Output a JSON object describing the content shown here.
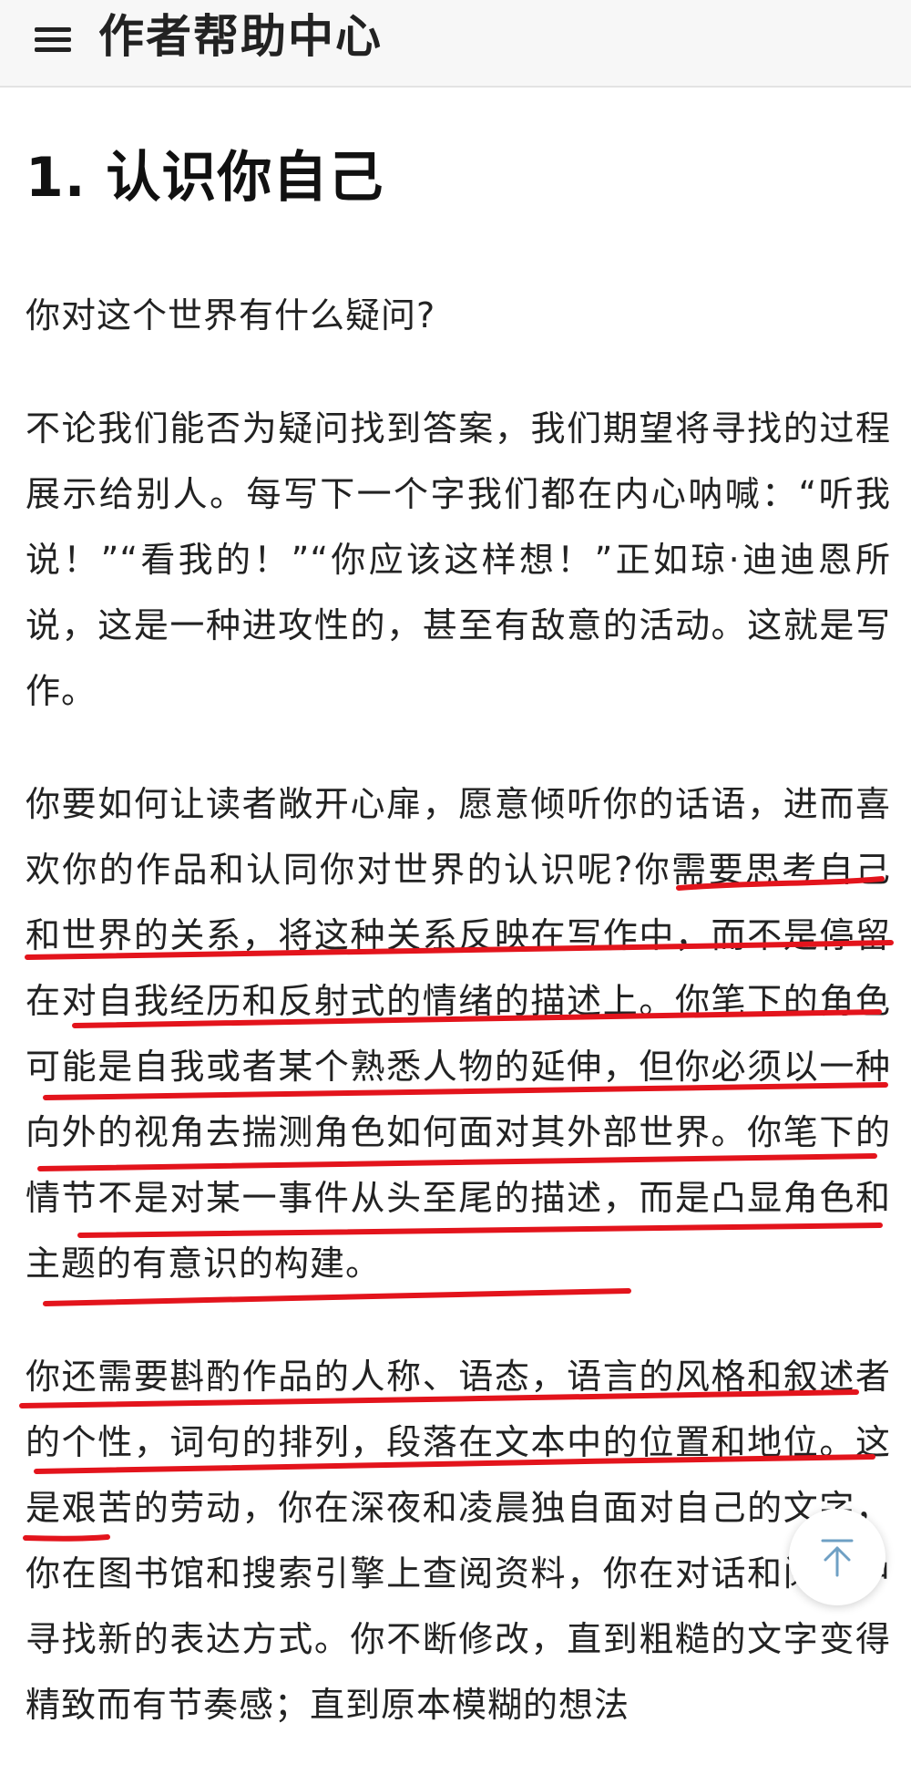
{
  "header": {
    "menu_icon": "hamburger-menu-icon",
    "title": "作者帮助中心"
  },
  "article": {
    "heading": "1. 认识你自己",
    "paragraphs": [
      "你对这个世界有什么疑问?",
      "不论我们能否为疑问找到答案，我们期望将寻找的过程展示给别人。每写下一个字我们都在内心呐喊：“听我说！”“看我的！”“你应该这样想！”正如琼·迪迪恩所说，这是一种进攻性的，甚至有敌意的活动。这就是写作。",
      "你要如何让读者敞开心扉，愿意倾听你的话语，进而喜欢你的作品和认同你对世界的认识呢?你需要思考自己和世界的关系，将这种关系反映在写作中，而不是停留在对自我经历和反射式的情绪的描述上。你笔下的角色可能是自我或者某个熟悉人物的延伸，但你必须以一种向外的视角去揣测角色如何面对其外部世界。你笔下的情节不是对某一事件从头至尾的描述，而是凸显角色和主题的有意识的构建。",
      "你还需要斟酌作品的人称、语态，语言的风格和叙述者的个性，词句的排列，段落在文本中的位置和地位。这是艰苦的劳动，你在深夜和凌晨独自面对自己的文字，你在图书馆和搜索引擎上查阅资料，你在对话和阅读中寻找新的表达方式。你不断修改，直到粗糙的文字变得精致而有节奏感；直到原本模糊的想法"
    ]
  },
  "back_to_top": {
    "icon": "arrow-up-to-top-icon",
    "color": "#6fa0c4"
  },
  "annotation": {
    "color": "#e3141c"
  }
}
